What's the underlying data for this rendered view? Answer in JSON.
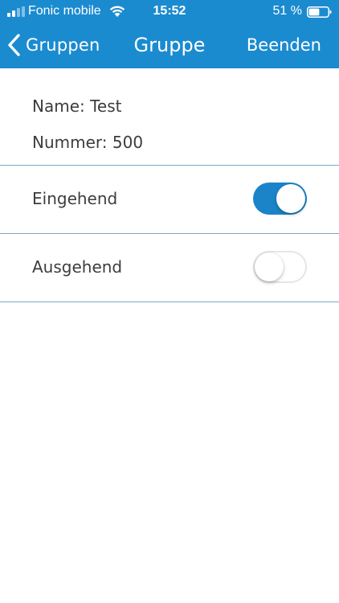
{
  "status_bar": {
    "carrier": "Fonic mobile",
    "time": "15:52",
    "battery_percent": "51 %"
  },
  "nav": {
    "back_label": "Gruppen",
    "title": "Gruppe",
    "done_label": "Beenden"
  },
  "group": {
    "name_line": "Name: Test",
    "number_line": "Nummer: 500"
  },
  "toggles": {
    "incoming": {
      "label": "Eingehend",
      "on": true
    },
    "outgoing": {
      "label": "Ausgehend",
      "on": false
    }
  },
  "colors": {
    "accent": "#1b8bd0",
    "switch_on": "#1b84c9",
    "divider": "#7aa9c4",
    "text": "#3d3d3d"
  },
  "icons": {
    "signal": "signal-bars-icon",
    "wifi": "wifi-icon",
    "battery": "battery-icon",
    "back": "chevron-left-icon"
  }
}
